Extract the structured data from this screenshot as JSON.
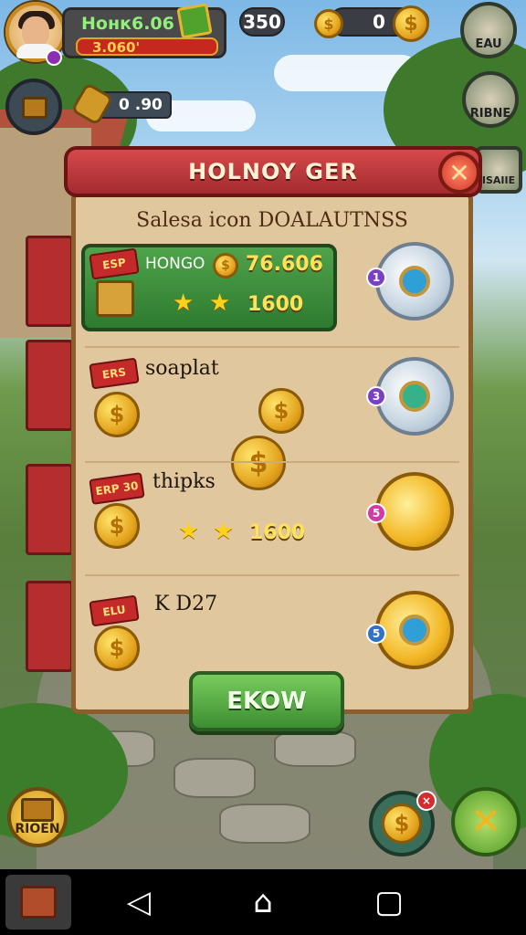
{
  "hud": {
    "player_name": "Hoнк6.06",
    "xp_text": "3.060'",
    "gems_count": "350",
    "coins_count": "0",
    "right_button_top_label": "EAU",
    "right_button_second_label": "RIBNE",
    "right_button_third_label": "ISAIIE",
    "sub_value": "0 .90"
  },
  "dialog": {
    "title": "HOLNOY GER",
    "subtitle": "Salesa icon DOALAUTNSS",
    "close_icon": "close-icon",
    "rows": [
      {
        "tag": "ESP",
        "label": "HONGO",
        "value": "76.606",
        "value2": "1600"
      },
      {
        "tag": "ERS",
        "label": "soaplat"
      },
      {
        "tag": "ERP 30",
        "label": "thipks",
        "value": "1600"
      },
      {
        "tag": "ELU",
        "label": "K D27"
      }
    ],
    "ok_label": "EKOW"
  },
  "bottom": {
    "left_button_label": "RIOEN"
  },
  "colors": {
    "dialog_header": "#c23a3c",
    "dialog_body": "#e1c79e",
    "featured_row": "#3f9140",
    "ok_button": "#56ad45"
  }
}
